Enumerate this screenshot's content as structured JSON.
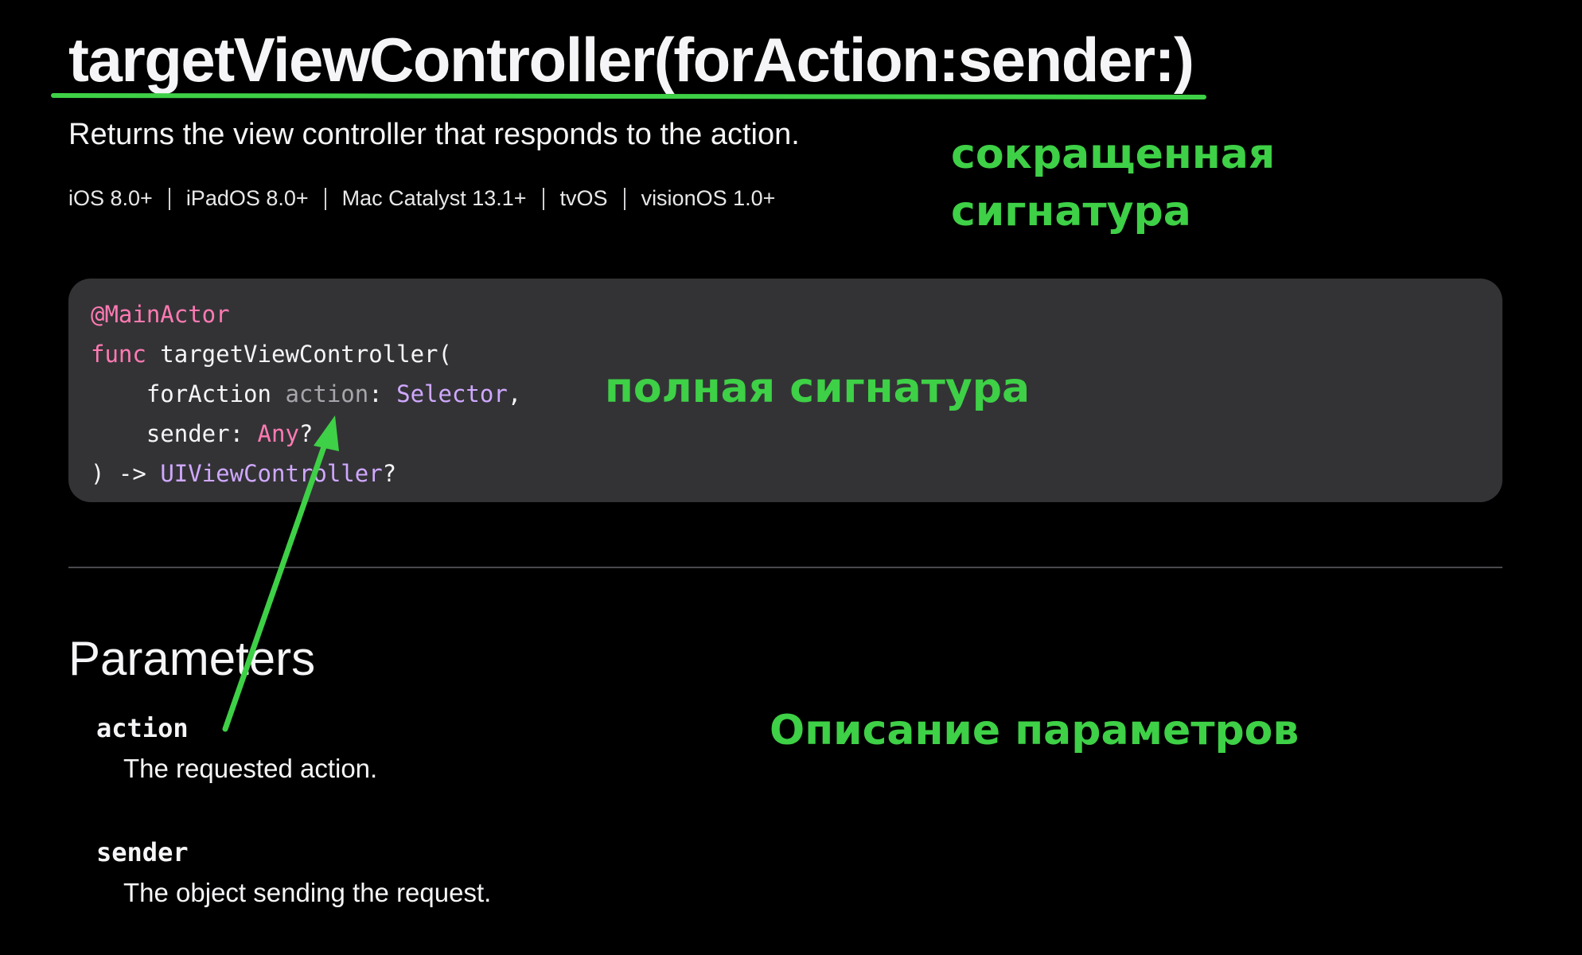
{
  "title": "targetViewController(forAction:sender:)",
  "abstract": "Returns the view controller that responds to the action.",
  "platforms": [
    "iOS 8.0+",
    "iPadOS 8.0+",
    "Mac Catalyst 13.1+",
    "tvOS",
    "visionOS 1.0+"
  ],
  "annotations": {
    "short_signature_line1": "сокращенная",
    "short_signature_line2": "сигнатура",
    "full_signature": "полная сигнатура",
    "params_description": "Описание параметров"
  },
  "code": {
    "attribute": "@MainActor",
    "func_kw": "func",
    "func_name": " targetViewController(",
    "label1": "    forAction ",
    "param1": "action",
    "colon1": ": ",
    "type1": "Selector",
    "comma1": ",",
    "label2": "    sender",
    "colon2": ": ",
    "type2": "Any",
    "optional2": "?",
    "close": ") -> ",
    "return_type": "UIViewController",
    "optional_ret": "?"
  },
  "parameters": {
    "heading": "Parameters",
    "items": [
      {
        "name": "action",
        "description": "The requested action."
      },
      {
        "name": "sender",
        "description": "The object sending the request."
      }
    ]
  },
  "colors": {
    "annotation_green": "#3ed046",
    "keyword_pink": "#ff7ab2",
    "type_purple": "#d0a8ff",
    "code_background": "#333336"
  }
}
